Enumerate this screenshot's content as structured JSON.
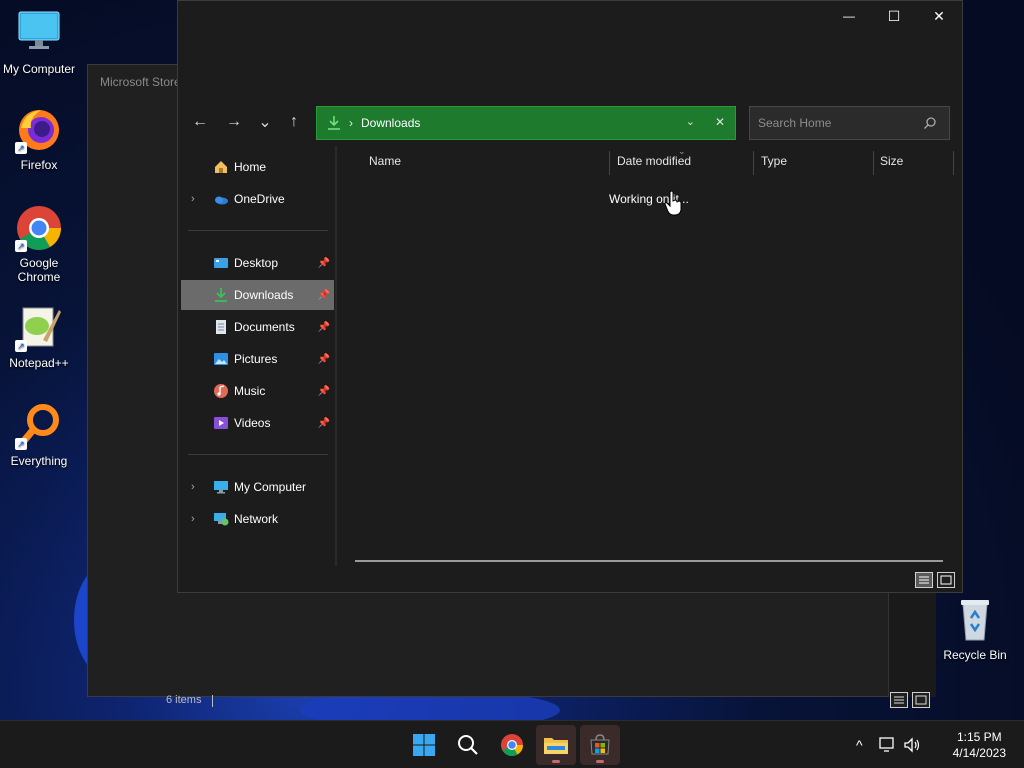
{
  "desktop": {
    "icons": [
      {
        "label": "My Computer",
        "icon": "monitor-icon"
      },
      {
        "label": "Firefox",
        "icon": "firefox-icon"
      },
      {
        "label": "Google Chrome",
        "icon": "chrome-icon"
      },
      {
        "label": "Notepad++",
        "icon": "notepadpp-icon"
      },
      {
        "label": "Everything",
        "icon": "everything-search-icon"
      }
    ],
    "recycle_bin": {
      "label": "Recycle Bin",
      "icon": "recycle-bin-icon"
    }
  },
  "background_window": {
    "title": "Microsoft Store",
    "status_text": "6 items"
  },
  "explorer": {
    "caption": {
      "minimize": "—",
      "maximize": "☐",
      "close": "✕"
    },
    "nav": {
      "back": "←",
      "forward": "→",
      "recent": "⌄",
      "up": "↑"
    },
    "address": {
      "separator": "›",
      "crumb": "Downloads",
      "dropdown": "⌄",
      "clear": "✕",
      "accent_color": "#1e7a2c"
    },
    "search": {
      "placeholder": "Search Home"
    },
    "nav_pane": {
      "items": [
        {
          "label": "Home",
          "icon": "home-icon"
        },
        {
          "label": "OneDrive",
          "icon": "onedrive-cloud-icon",
          "expandable": true
        },
        {
          "label": "Desktop",
          "icon": "desktop-folder-icon",
          "pinned": true
        },
        {
          "label": "Downloads",
          "icon": "downloads-folder-icon",
          "pinned": true,
          "selected": true
        },
        {
          "label": "Documents",
          "icon": "documents-folder-icon",
          "pinned": true
        },
        {
          "label": "Pictures",
          "icon": "pictures-folder-icon",
          "pinned": true
        },
        {
          "label": "Music",
          "icon": "music-folder-icon",
          "pinned": true
        },
        {
          "label": "Videos",
          "icon": "videos-folder-icon",
          "pinned": true
        },
        {
          "label": "My Computer",
          "icon": "monitor-icon",
          "expandable": true
        },
        {
          "label": "Network",
          "icon": "network-icon",
          "expandable": true
        }
      ]
    },
    "columns": [
      "Name",
      "Date modified",
      "Type",
      "Size"
    ],
    "status_message": "Working on it..."
  },
  "taskbar": {
    "apps": [
      {
        "name": "start-button",
        "icon": "windows-logo-icon"
      },
      {
        "name": "search-button",
        "icon": "search-icon"
      },
      {
        "name": "chrome-button",
        "icon": "chrome-icon"
      },
      {
        "name": "file-explorer-button",
        "icon": "file-explorer-icon",
        "active": true
      },
      {
        "name": "microsoft-store-button",
        "icon": "store-icon",
        "active": true
      }
    ],
    "tray": {
      "chevron": "^",
      "time": "1:15 PM",
      "date": "4/14/2023"
    }
  }
}
